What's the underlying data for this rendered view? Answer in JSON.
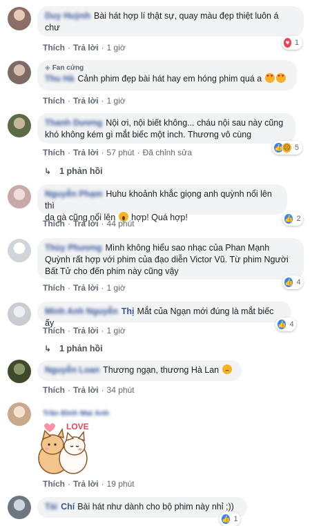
{
  "actions": {
    "like": "Thích",
    "reply": "Trả lời",
    "edited": "Đã chỉnh sửa"
  },
  "comments": [
    {
      "author": "Duy Huỳnh",
      "text": "Bài hát hợp lí thật sự, quay màu đẹp thiệt luôn á",
      "text2": "chư",
      "time": "1 giờ",
      "reaction_count": "1",
      "reaction": "love",
      "avatar_color": "#b8a39c"
    },
    {
      "badge": "Fan cứng",
      "author": "Thu Hà",
      "text": "Cảnh phim đẹp bài hát hay em hóng phim quá a",
      "time": "1 giờ",
      "avatar_color": "#a89a93"
    },
    {
      "author": "Thanh Dương",
      "text": "Nội ơi, nội biết không... cháu nội sau này cũng",
      "text2": "khó không kém gì mắt biếc một inch. Thương vô cùng",
      "time": "57 phút",
      "reaction_count": "5",
      "reaction": "like-sad",
      "replies": "1 phản hồi",
      "avatar_color": "#6e7a55"
    },
    {
      "author": "Nguyễn Phạm",
      "text": "Huhu khoảnh khắc giọng anh quỳnh nổi lên thì",
      "text2": "da gà cũng nổi lên",
      "text2b": "hợp! Quá hợp!",
      "time": "44 phút",
      "reaction_count": "2",
      "reaction": "like",
      "avatar_color": "#d6c3c3"
    },
    {
      "author": "Thùy Phương",
      "text": "Mình không hiểu sao nhạc của Phan Mạnh",
      "text2": "Quỳnh rất hợp với phim của đạo diễn Victor Vũ. Từ phim Người",
      "text3": "Bất Tử cho đến phim này cũng vậy",
      "time": "1 giờ",
      "reaction_count": "4",
      "reaction": "like",
      "avatar_color": "#d9dadc"
    },
    {
      "author": "Minh Anh Nguyễn",
      "author_clear": "Thị",
      "text": "Mắt của Ngạn mới đúng là mắt biếc ấy",
      "time": "1 giờ",
      "reaction_count": "4",
      "reaction": "like",
      "replies": "1 phản hồi",
      "avatar_color": "#d0d3d8"
    },
    {
      "author": "Nguyễn Loan",
      "text": "Thương ngạn, thương Hà Lan",
      "time": "34 phút",
      "avatar_color": "#4d5a3a"
    },
    {
      "author": "Trần Đình Mai Anh",
      "sticker_text": "LOVE",
      "time": "19 phút",
      "avatar_color": "#e5cfb8"
    },
    {
      "author": "Tài",
      "author_clear": "Chí",
      "text": "Bài hát như dành cho bộ phim này nhỉ ;))",
      "reaction_count": "1",
      "reaction": "like",
      "avatar_color": "#9aa3ad"
    }
  ]
}
